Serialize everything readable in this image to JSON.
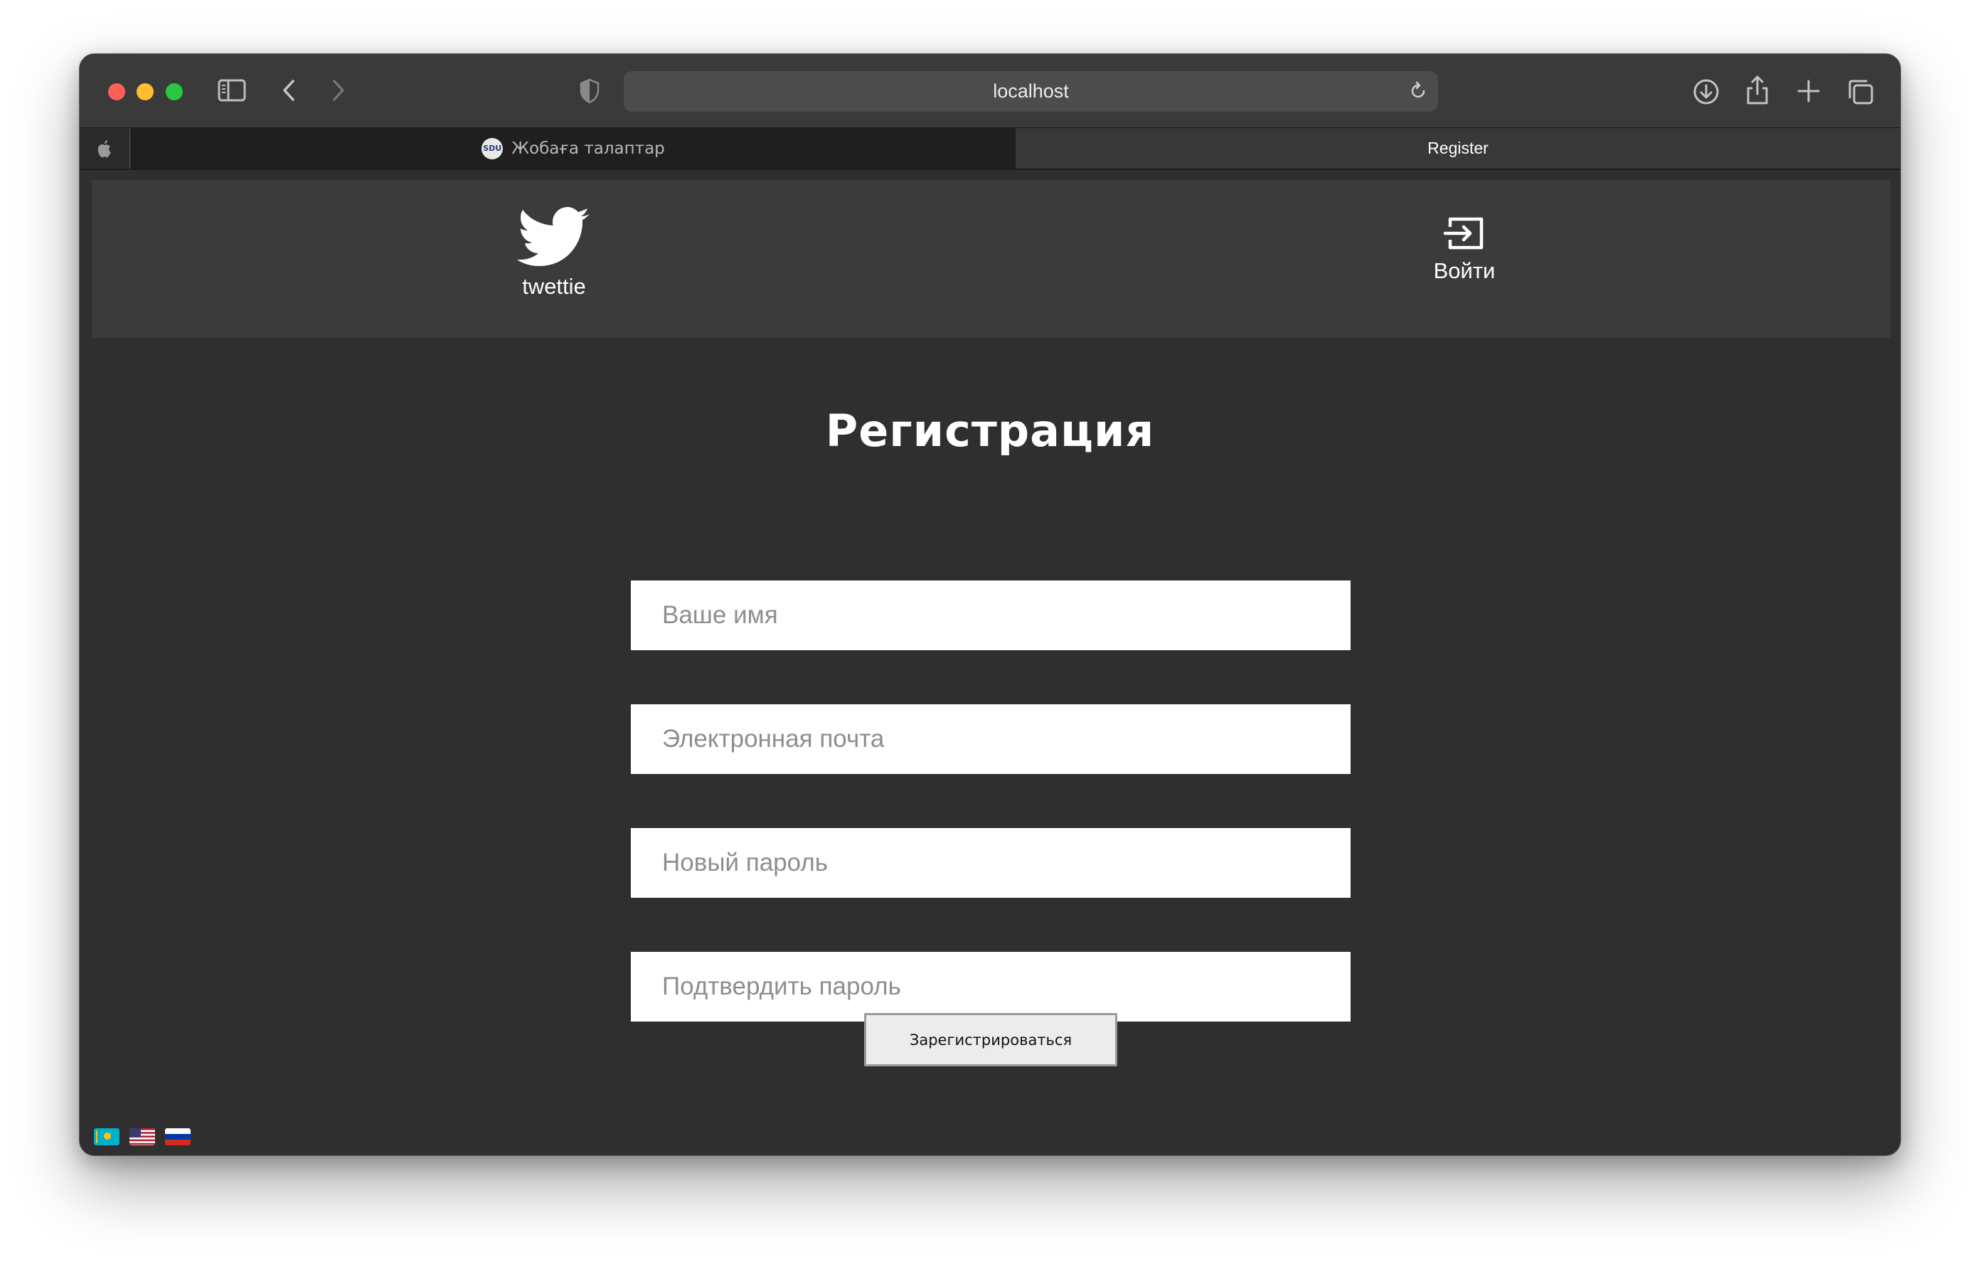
{
  "browser": {
    "address": "localhost",
    "tabs": [
      {
        "label": "Жобаға талаптар",
        "active": false,
        "favicon_text": "SDU"
      },
      {
        "label": "Register",
        "active": true
      }
    ],
    "icons": [
      "sidebar-icon",
      "back-icon",
      "forward-icon",
      "shield-icon",
      "reload-icon",
      "download-icon",
      "share-icon",
      "new-tab-icon",
      "tab-overview-icon",
      "apple-icon"
    ]
  },
  "header": {
    "logo_text": "twettie",
    "login_label": "Войти"
  },
  "form": {
    "title": "Регистрация",
    "fields": [
      {
        "placeholder": "Ваше имя",
        "value": ""
      },
      {
        "placeholder": "Электронная почта",
        "value": ""
      },
      {
        "placeholder": "Новый пароль",
        "value": ""
      },
      {
        "placeholder": "Подтвердить пароль",
        "value": ""
      }
    ],
    "submit_label": "Зарегистрироваться"
  },
  "languages": [
    "kz",
    "us",
    "ru"
  ],
  "colors": {
    "page_background": "#2f2f2f",
    "header_background": "#3b3b3b",
    "text": "#ffffff"
  }
}
